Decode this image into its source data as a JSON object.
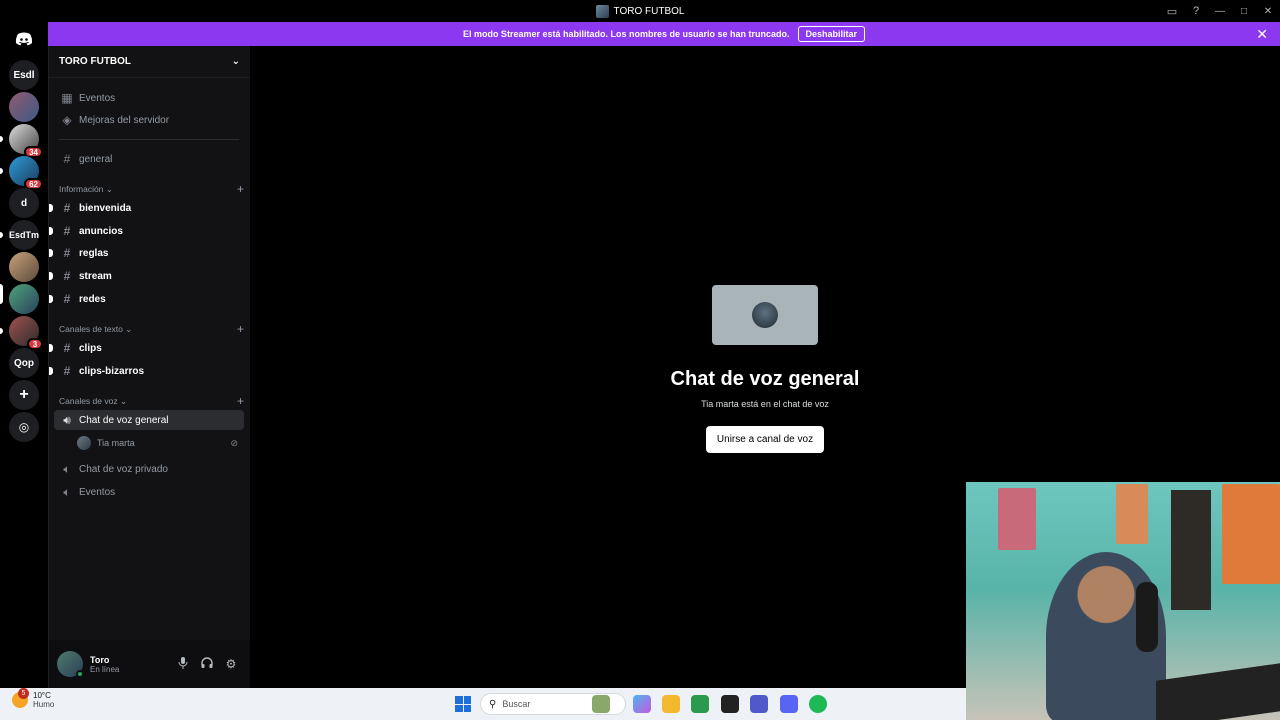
{
  "window": {
    "title": "TORO FUTBOL"
  },
  "banner": {
    "message": "El modo Streamer está habilitado. Los nombres de usuario se han truncado.",
    "button_label": "Deshabilitar"
  },
  "servers": [
    {
      "label": "Esdl",
      "kind": "text"
    },
    {
      "label": "",
      "kind": "image"
    },
    {
      "label": "",
      "kind": "image",
      "badge": "34"
    },
    {
      "label": "",
      "kind": "image",
      "badge": "62"
    },
    {
      "label": "d",
      "kind": "text"
    },
    {
      "label": "EsdTm",
      "kind": "text"
    },
    {
      "label": "",
      "kind": "image"
    },
    {
      "label": "",
      "kind": "image"
    },
    {
      "label": "",
      "kind": "image",
      "badge": "3"
    },
    {
      "label": "Qop",
      "kind": "text"
    }
  ],
  "sidebar": {
    "server_name": "TORO FUTBOL",
    "top_items": [
      {
        "label": "Eventos",
        "icon": "calendar-icon"
      },
      {
        "label": "Mejoras del servidor",
        "icon": "boost-icon"
      }
    ],
    "general_channel": "general",
    "categories": {
      "informacion": "Información",
      "texto": "Canales de texto",
      "voz": "Canales de voz"
    },
    "info_channels": [
      "bienvenida",
      "anuncios",
      "reglas",
      "stream",
      "redes"
    ],
    "text_channels": [
      "clips",
      "clips-bizarros"
    ],
    "voice_channels": [
      {
        "label": "Chat de voz general",
        "selected": true
      },
      {
        "label": "Chat de voz privado",
        "selected": false
      },
      {
        "label": "Eventos",
        "selected": false
      }
    ],
    "voice_user": "Tia marta"
  },
  "user": {
    "name": "Toro",
    "status": "En línea"
  },
  "main": {
    "title": "Chat de voz general",
    "subtitle": "Tia marta está en el chat de voz",
    "join_label": "Unirse a canal de voz"
  },
  "taskbar": {
    "weather_badge": "5",
    "temperature": "10°C",
    "condition": "Humo",
    "search_placeholder": "Buscar"
  },
  "colors": {
    "banner": "#8c37f0",
    "sidebar": "#121214",
    "online": "#23a55a",
    "badge": "#da373c"
  }
}
